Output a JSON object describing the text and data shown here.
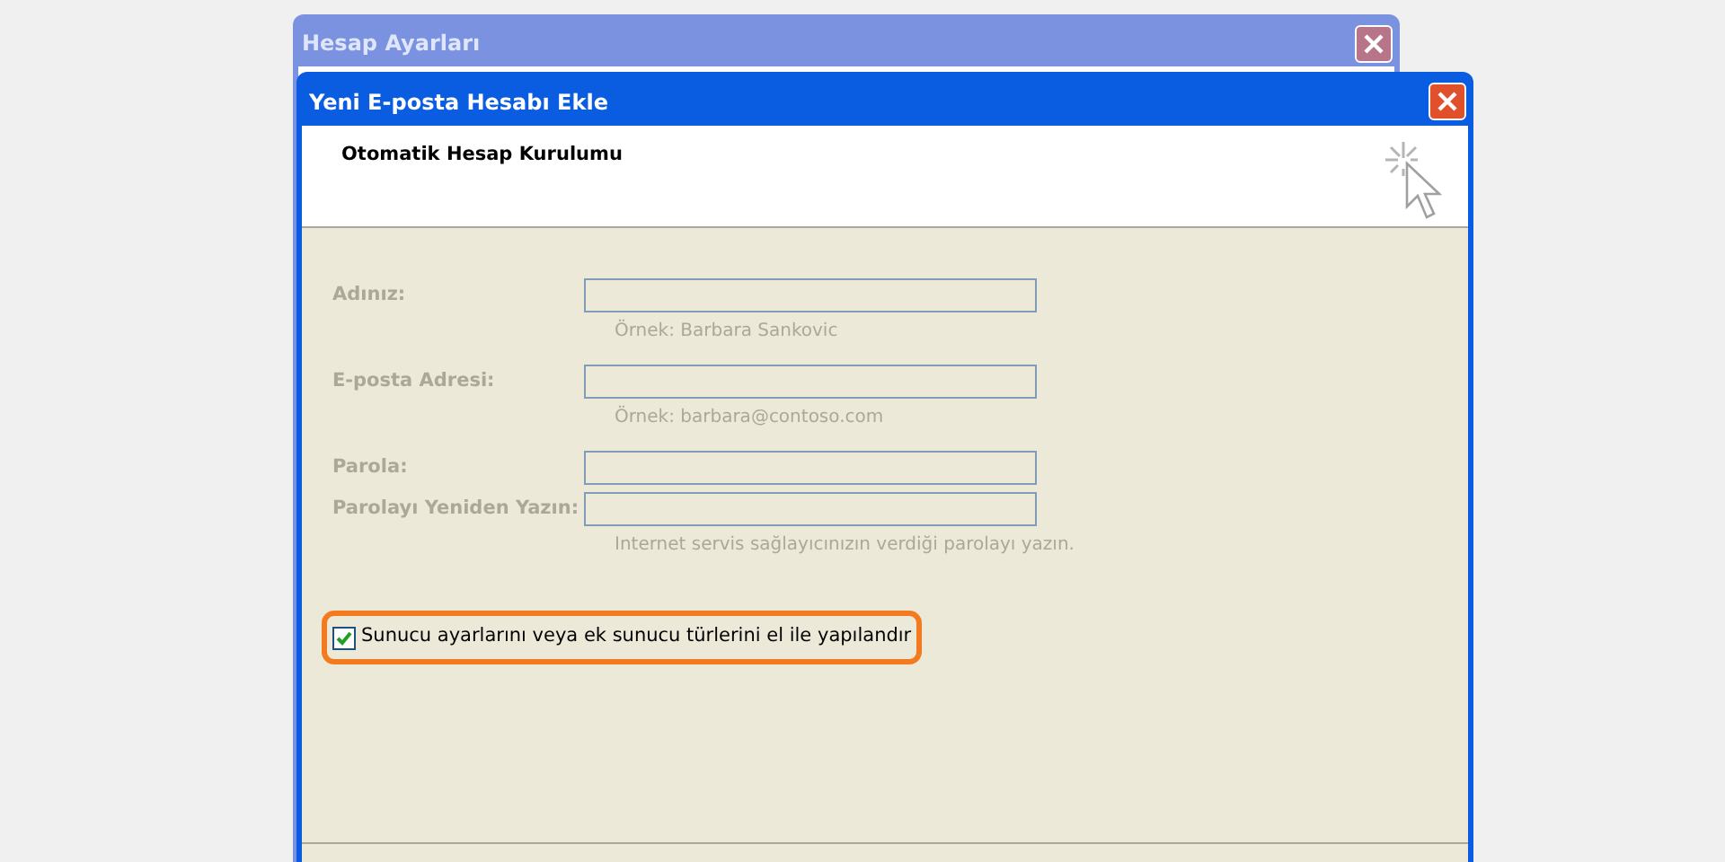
{
  "back_window": {
    "title": "Hesap Ayarları",
    "active": false
  },
  "window": {
    "title": "Yeni E-posta Hesabı Ekle",
    "active": true
  },
  "header": {
    "title": "Otomatik Hesap Kurulumu"
  },
  "fields": [
    {
      "label": "Adınız:",
      "hint": "Örnek: Barbara Sankovic",
      "disabled": true
    },
    {
      "label": "E-posta Adresi:",
      "hint": "Örnek: barbara@contoso.com",
      "disabled": true
    },
    {
      "label": "Parola:",
      "disabled": true
    },
    {
      "label": "Parolayı Yeniden Yazın:",
      "hint": "Internet servis sağlayıcınızın verdiği parolayı yazın.",
      "disabled": true
    }
  ],
  "manual_setup": {
    "label": "Sunucu ayarlarını veya ek sunucu türlerini el ile yapılandır",
    "checked": true,
    "highlighted": true
  }
}
